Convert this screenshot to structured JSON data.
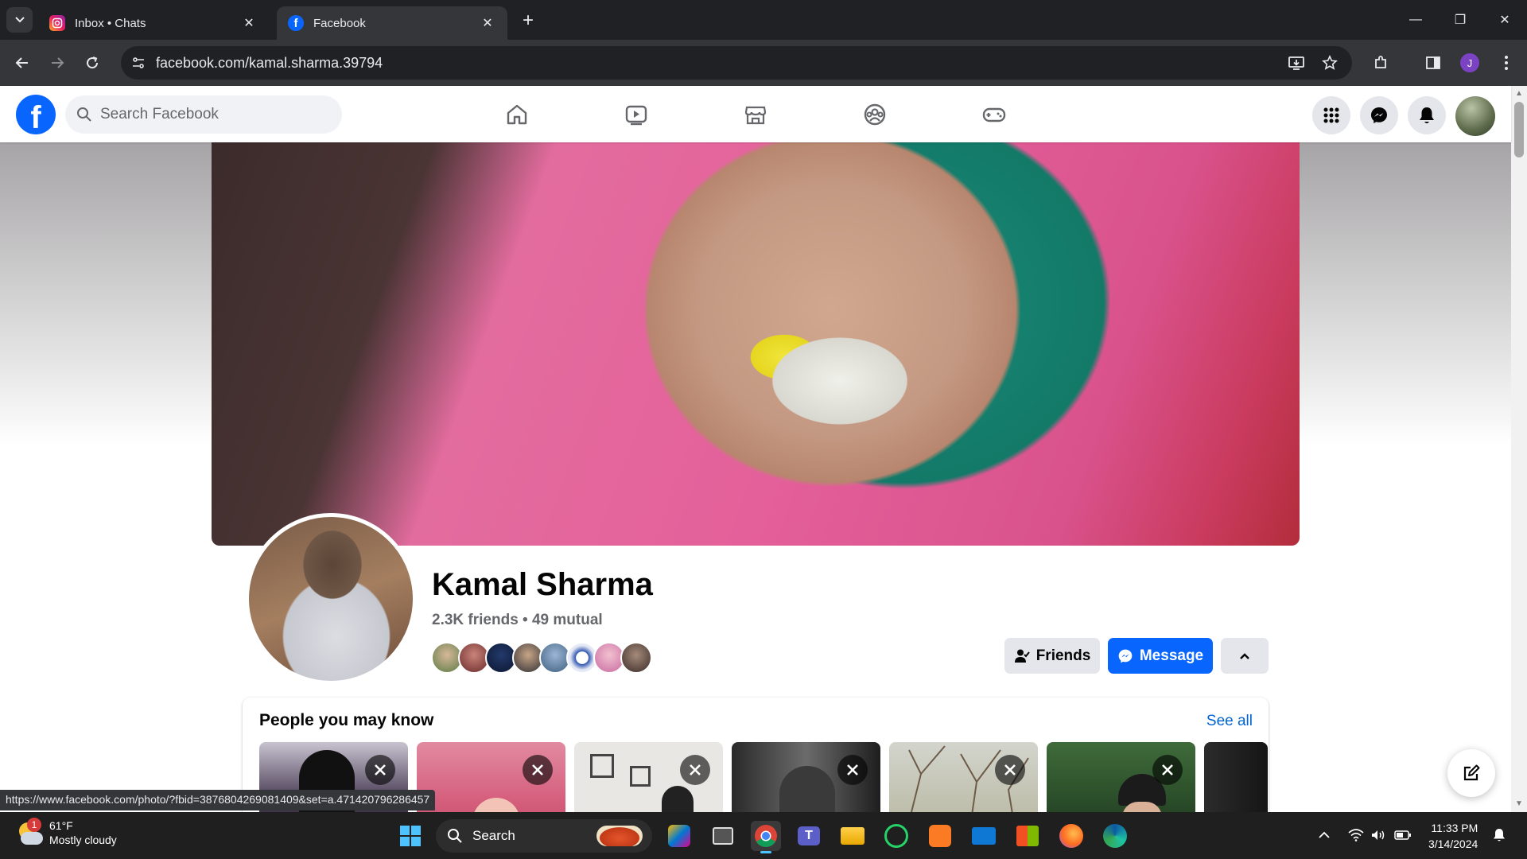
{
  "browser": {
    "tabs": [
      {
        "title": "Inbox • Chats",
        "favicon": "instagram-icon",
        "active": false
      },
      {
        "title": "Facebook",
        "favicon": "facebook-icon",
        "active": true
      }
    ],
    "url": "facebook.com/kamal.sharma.39794",
    "profile_initial": "J",
    "status_url": "https://www.facebook.com/photo/?fbid=3876804269081409&set=a.471420796286457"
  },
  "fb": {
    "search_placeholder": "Search Facebook",
    "nav": [
      "home-icon",
      "watch-icon",
      "marketplace-icon",
      "groups-icon",
      "gaming-icon"
    ],
    "profile": {
      "name": "Kamal Sharma",
      "friends_summary": "2.3K friends • 49 mutual",
      "friends_button": "Friends",
      "message_button": "Message"
    },
    "pymk": {
      "title": "People you may know",
      "see_all": "See all"
    },
    "brand_color": "#0866ff"
  },
  "taskbar": {
    "weather_temp": "61°F",
    "weather_desc": "Mostly cloudy",
    "weather_badge": "1",
    "search_label": "Search",
    "time": "11:33 PM",
    "date": "3/14/2024"
  }
}
